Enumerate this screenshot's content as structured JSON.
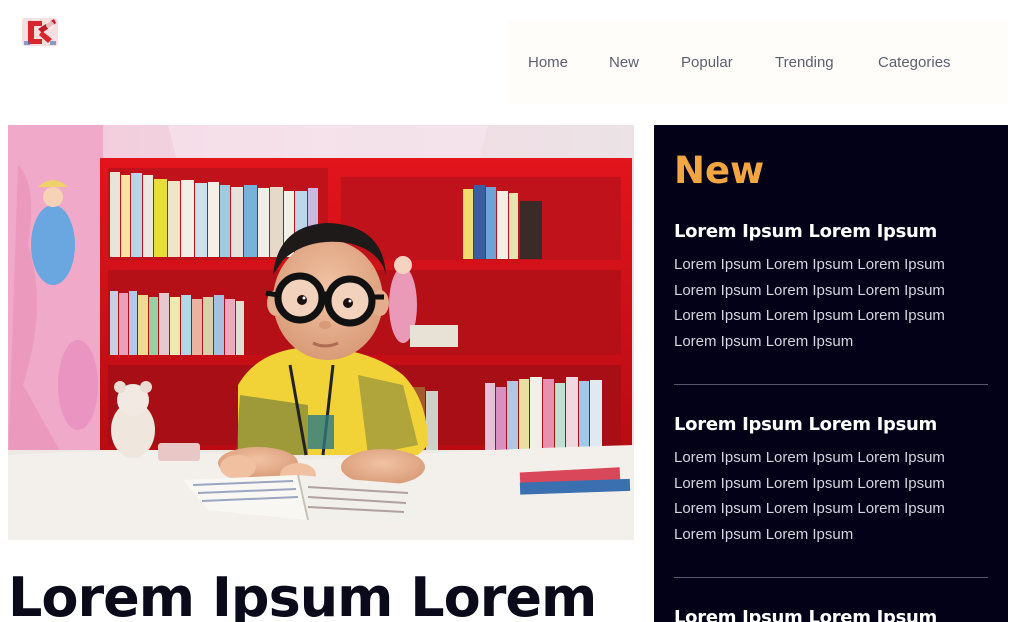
{
  "nav": {
    "items": [
      "Home",
      "New",
      "Popular",
      "Trending",
      "Categories"
    ]
  },
  "hero": {
    "alt": "Child with glasses reading a book in front of a red bookshelf"
  },
  "headline": "Lorem Ipsum Lorem",
  "sidebar": {
    "title": "New",
    "items": [
      {
        "title": "Lorem Ipsum Lorem Ipsum",
        "body": "Lorem Ipsum Lorem Ipsum Lorem Ipsum Lorem Ipsum Lorem Ipsum Lorem Ipsum Lorem Ipsum Lorem Ipsum Lorem Ipsum Lorem Ipsum Lorem Ipsum"
      },
      {
        "title": "Lorem Ipsum Lorem Ipsum",
        "body": "Lorem Ipsum Lorem Ipsum Lorem Ipsum Lorem Ipsum Lorem Ipsum Lorem Ipsum Lorem Ipsum Lorem Ipsum Lorem Ipsum Lorem Ipsum Lorem Ipsum"
      },
      {
        "title": "Lorem Ipsum Lorem Ipsum",
        "body": ""
      }
    ]
  },
  "colors": {
    "accent": "#f2a541",
    "sidebar_bg": "#020118",
    "nav_bg": "#fffdfa",
    "logo_red": "#d7262e"
  }
}
